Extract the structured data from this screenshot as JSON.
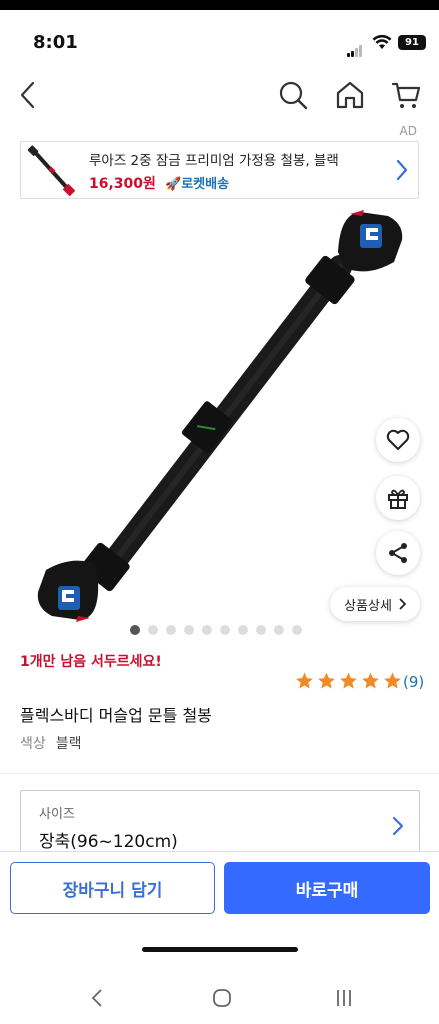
{
  "status": {
    "time": "8:01",
    "battery": "91"
  },
  "topnav": {
    "back_icon": "chevron-left-icon",
    "search_icon": "search-icon",
    "home_icon": "home-icon",
    "cart_icon": "cart-icon"
  },
  "ad": {
    "label": "AD",
    "title": "루아즈 2중 잠금 프리미엄 가정용 철봉, 블랙",
    "price": "16,300원",
    "shipping": "로켓배송",
    "shipping_icon": "rocket-icon"
  },
  "gallery": {
    "dots_total": 10,
    "active_dot": 1,
    "actions": [
      {
        "name": "wishlist",
        "icon": "heart-icon"
      },
      {
        "name": "gift",
        "icon": "gift-icon"
      },
      {
        "name": "share",
        "icon": "share-icon"
      }
    ],
    "detail_label": "상품상세"
  },
  "product": {
    "stock_notice": "1개만 남음 서두르세요!",
    "rating_stars": 5,
    "review_count": "(9)",
    "name": "플렉스바디 머슬업 문틀 철봉",
    "option_key": "색상",
    "option_value": "블랙"
  },
  "size_selector": {
    "label": "사이즈",
    "value": "장축(96~120cm)"
  },
  "actions": {
    "add_to_cart": "장바구니 담기",
    "buy_now": "바로구매"
  },
  "colors": {
    "accent_blue": "#346aff",
    "price_red": "#c8102e",
    "rating_orange": "#f08a24"
  }
}
